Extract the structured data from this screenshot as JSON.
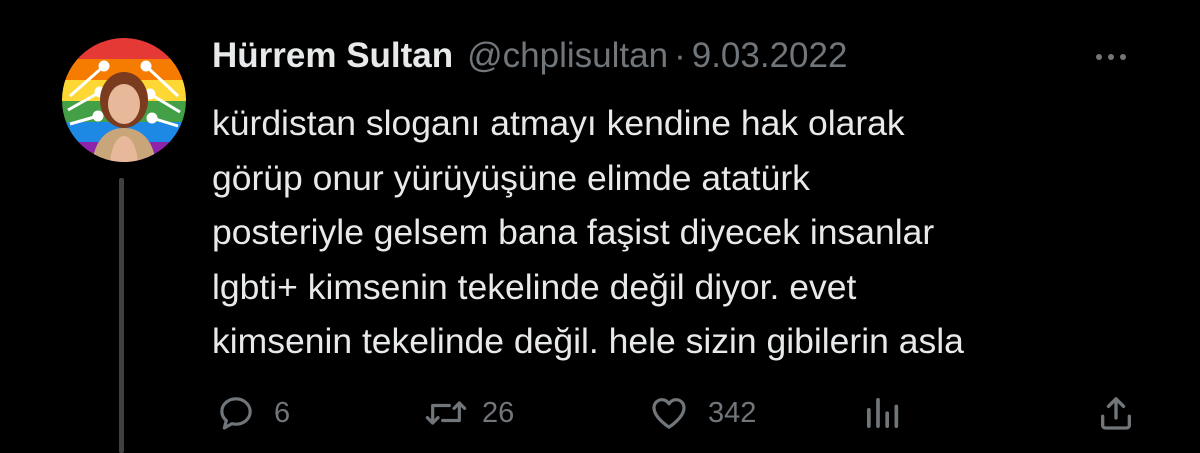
{
  "tweet": {
    "display_name": "Hürrem Sultan",
    "handle": "@chplisultan",
    "separator": "·",
    "date": "9.03.2022",
    "text_lines": [
      "kürdistan sloganı atmayı kendine hak olarak",
      "görüp onur yürüyüşüne elimde atatürk",
      "posteriyle gelsem bana faşist diyecek insanlar",
      "lgbti+ kimsenin tekelinde değil diyor. evet",
      "kimsenin tekelinde değil. hele sizin gibilerin asla"
    ]
  },
  "actions": {
    "replies": "6",
    "retweets": "26",
    "likes": "342"
  },
  "icons": {
    "reply": "reply-icon",
    "retweet": "retweet-icon",
    "like": "heart-icon",
    "views": "analytics-icon",
    "share": "share-icon",
    "more": "more-icon"
  },
  "colors": {
    "background": "#000000",
    "text": "#e7e9ea",
    "secondary": "#71767b"
  }
}
